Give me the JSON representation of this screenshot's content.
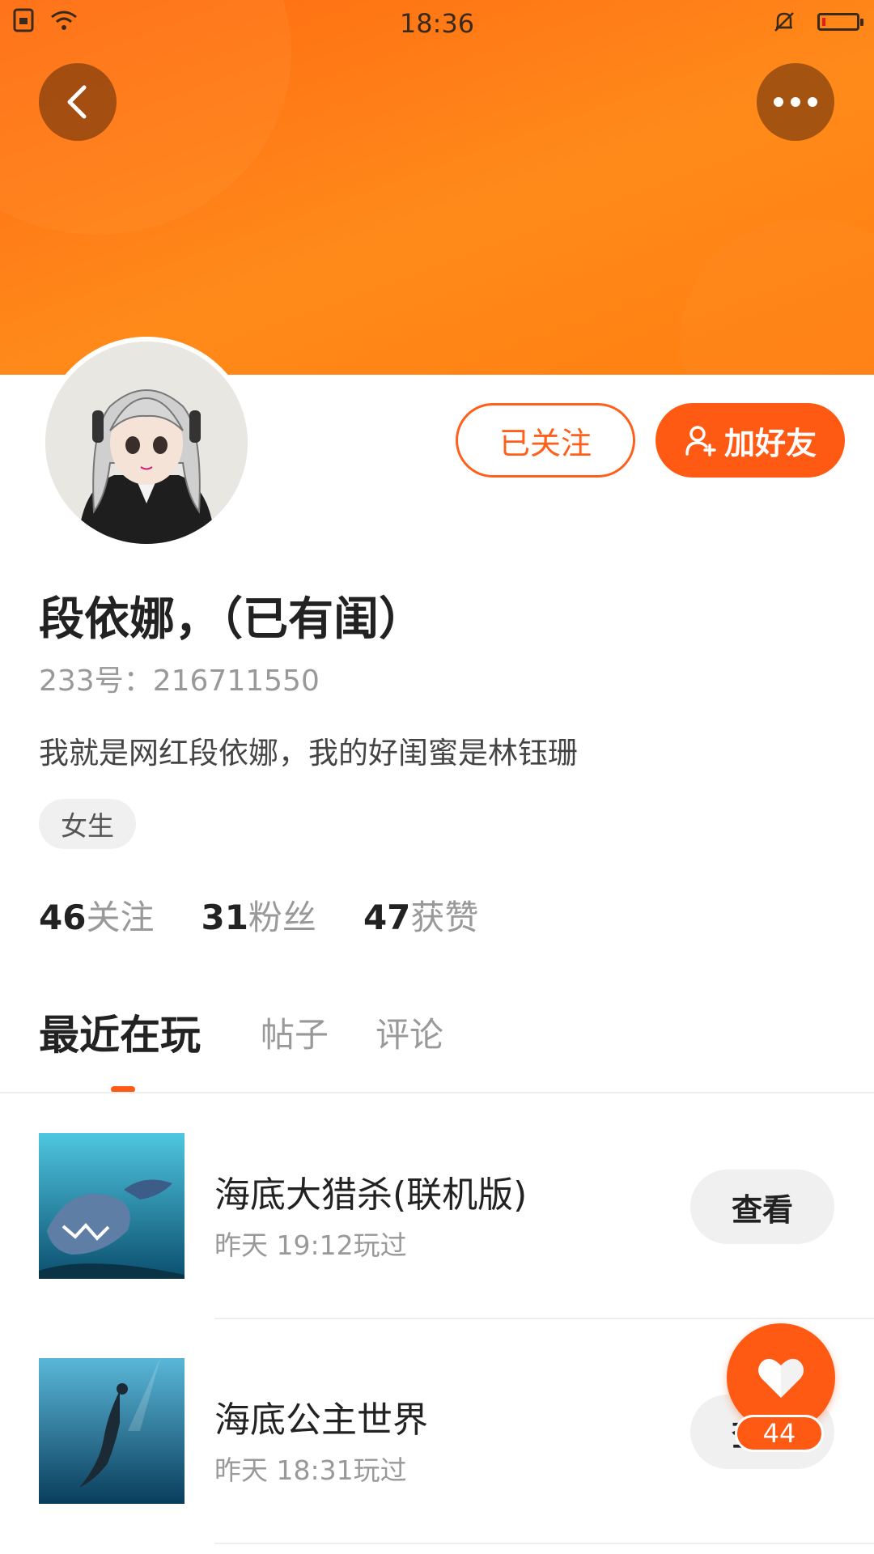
{
  "status_bar": {
    "time": "18:36"
  },
  "profile": {
    "name": "段依娜，（已有闺）",
    "uid": "233号：216711550",
    "bio": "我就是网红段依娜，我的好闺蜜是林钰珊",
    "tag": "女生",
    "followed_label": "已关注",
    "add_friend_label": "加好友"
  },
  "stats": [
    {
      "value": "46",
      "label": "关注"
    },
    {
      "value": "31",
      "label": "粉丝"
    },
    {
      "value": "47",
      "label": "获赞"
    }
  ],
  "tabs": [
    {
      "label": "最近在玩",
      "active": true
    },
    {
      "label": "帖子",
      "active": false
    },
    {
      "label": "评论",
      "active": false
    }
  ],
  "games": [
    {
      "title": "海底大猎杀(联机版)",
      "played": "昨天 19:12玩过",
      "action": "查看"
    },
    {
      "title": "海底公主世界",
      "played": "昨天 18:31玩过",
      "action": "查看"
    }
  ],
  "fab": {
    "count": "44"
  },
  "colors": {
    "accent": "#ff5a14",
    "header_gradient": [
      "#ff6a12",
      "#ff8a1a"
    ]
  },
  "icons": {
    "back": "chevron-left-icon",
    "more": "more-dots-icon",
    "add_friend": "add-user-icon",
    "fab": "heart-icon"
  }
}
